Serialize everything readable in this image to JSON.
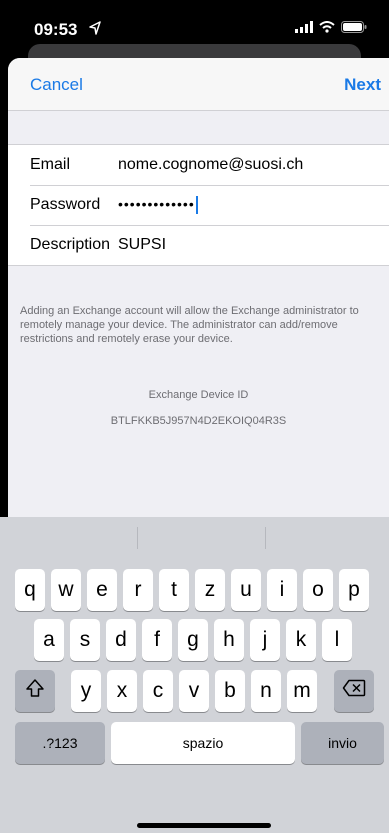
{
  "status_bar": {
    "time": "09:53"
  },
  "nav": {
    "cancel_label": "Cancel",
    "next_label": "Next"
  },
  "form": {
    "email": {
      "label": "Email",
      "value": "nome.cognome@suosi.ch"
    },
    "password": {
      "label": "Password",
      "value": "•••••••••••••"
    },
    "description": {
      "label": "Description",
      "value": "SUPSI"
    }
  },
  "info_text": "Adding an Exchange account will allow the Exchange administrator to remotely manage your device. The administrator can add/remove restrictions and remotely erase your device.",
  "device_id": {
    "label": "Exchange Device ID",
    "value": "BTLFKKB5J957N4D2EKOIQ04R3S"
  },
  "keyboard": {
    "row1": [
      "q",
      "w",
      "e",
      "r",
      "t",
      "z",
      "u",
      "i",
      "o",
      "p"
    ],
    "row2": [
      "a",
      "s",
      "d",
      "f",
      "g",
      "h",
      "j",
      "k",
      "l"
    ],
    "row3": [
      "y",
      "x",
      "c",
      "v",
      "b",
      "n",
      "m"
    ],
    "numbers_label": ".?123",
    "space_label": "spazio",
    "return_label": "invio",
    "shift_icon": "shift-icon",
    "delete_icon": "delete-icon"
  },
  "colors": {
    "accent": "#1a7ae6",
    "sheet_bg": "#efeff4",
    "keyboard_bg": "#d1d3d8"
  }
}
